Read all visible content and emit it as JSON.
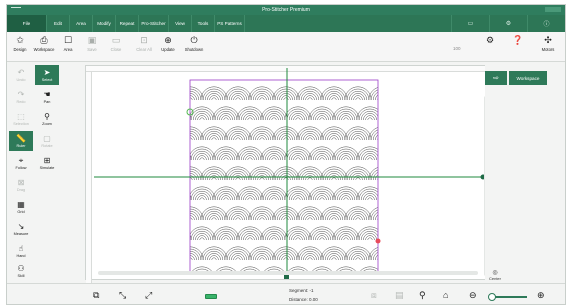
{
  "title": "Pro-Stitcher Premium",
  "menu": {
    "file": "File",
    "items": [
      "Edit",
      "Area",
      "Modify",
      "Repeat",
      "Pro-Stitcher",
      "View",
      "Tools",
      "PS Patterns"
    ],
    "right_icons": [
      "monitor-icon",
      "settings-icon",
      "info-icon"
    ]
  },
  "toolbar": {
    "design": "Design",
    "workspace": "Workspace",
    "area": "Area",
    "save": "Save",
    "close": "Close",
    "clear_all": "Clear All",
    "update": "Update",
    "shutdown": "Shutdown",
    "zoom_percent": "100",
    "motors": "Motors"
  },
  "left_tools": {
    "undo": "Undo",
    "select": "Select",
    "redo": "Redo",
    "pan": "Pan",
    "selection": "Selection",
    "zoom": "Zoom",
    "ruler": "Ruler",
    "rotate": "Rotate",
    "follow": "Follow",
    "simulate": "Simulate",
    "drag": "Drag",
    "grid": "Grid",
    "measure": "Measure",
    "hand": "Hand",
    "skill": "Skill"
  },
  "right_panel": {
    "workspace_tab": "Workspace",
    "center": "Center"
  },
  "status": {
    "segment_label": "Segment:",
    "segment_value": "-1",
    "distance_label": "Distance:",
    "distance_value": "0.00"
  },
  "colors": {
    "accent": "#2d7656",
    "design_outline": "#9b3cc8",
    "crosshair": "#1f8a3c",
    "start_marker": "#52b84f",
    "end_marker": "#e84b5a"
  }
}
